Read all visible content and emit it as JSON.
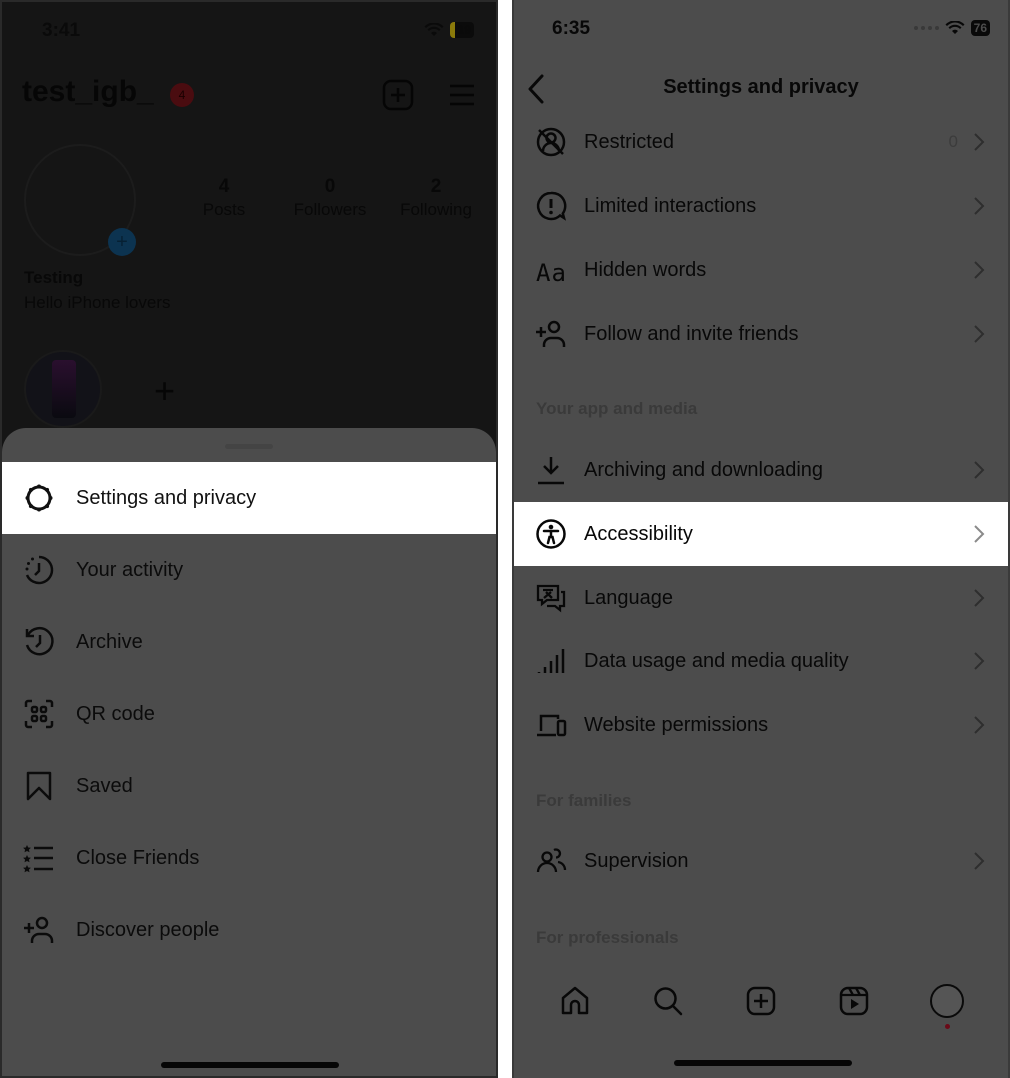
{
  "left_screen": {
    "status_bar": {
      "time": "3:41",
      "battery": "19"
    },
    "profile": {
      "username": "test_igb_",
      "notification_count": "4",
      "stats": [
        {
          "value": "4",
          "label": "Posts"
        },
        {
          "value": "0",
          "label": "Followers"
        },
        {
          "value": "2",
          "label": "Following"
        }
      ],
      "display_name": "Testing",
      "bio": "Hello iPhone lovers",
      "add_highlight_symbol": "+"
    },
    "menu_sheet": {
      "items": [
        {
          "label": "Settings and privacy",
          "icon": "gear-icon",
          "highlighted": true
        },
        {
          "label": "Your activity",
          "icon": "activity-icon",
          "highlighted": false
        },
        {
          "label": "Archive",
          "icon": "archive-icon",
          "highlighted": false
        },
        {
          "label": "QR code",
          "icon": "qr-code-icon",
          "highlighted": false
        },
        {
          "label": "Saved",
          "icon": "bookmark-icon",
          "highlighted": false
        },
        {
          "label": "Close Friends",
          "icon": "close-friends-list-icon",
          "highlighted": false
        },
        {
          "label": "Discover people",
          "icon": "add-person-icon",
          "highlighted": false
        }
      ]
    }
  },
  "right_screen": {
    "status_bar": {
      "time": "6:35",
      "battery": "76"
    },
    "header": {
      "title": "Settings and privacy"
    },
    "items": [
      {
        "label": "Restricted",
        "icon": "restricted-icon",
        "count": "0"
      },
      {
        "label": "Limited interactions",
        "icon": "limited-interactions-icon"
      },
      {
        "label": "Hidden words",
        "icon": "hidden-words-icon"
      },
      {
        "label": "Follow and invite friends",
        "icon": "add-person-icon"
      }
    ],
    "sections": [
      {
        "title": "Your app and media",
        "items": [
          {
            "label": "Archiving and downloading",
            "icon": "download-icon"
          },
          {
            "label": "Accessibility",
            "icon": "accessibility-icon",
            "highlighted": true
          },
          {
            "label": "Language",
            "icon": "language-icon"
          },
          {
            "label": "Data usage and media quality",
            "icon": "signal-bars-icon"
          },
          {
            "label": "Website permissions",
            "icon": "devices-icon"
          }
        ]
      },
      {
        "title": "For families",
        "items": [
          {
            "label": "Supervision",
            "icon": "supervision-icon"
          }
        ]
      },
      {
        "title": "For professionals",
        "items": []
      }
    ],
    "tab_bar": [
      "home",
      "search",
      "create",
      "reels",
      "profile"
    ]
  }
}
